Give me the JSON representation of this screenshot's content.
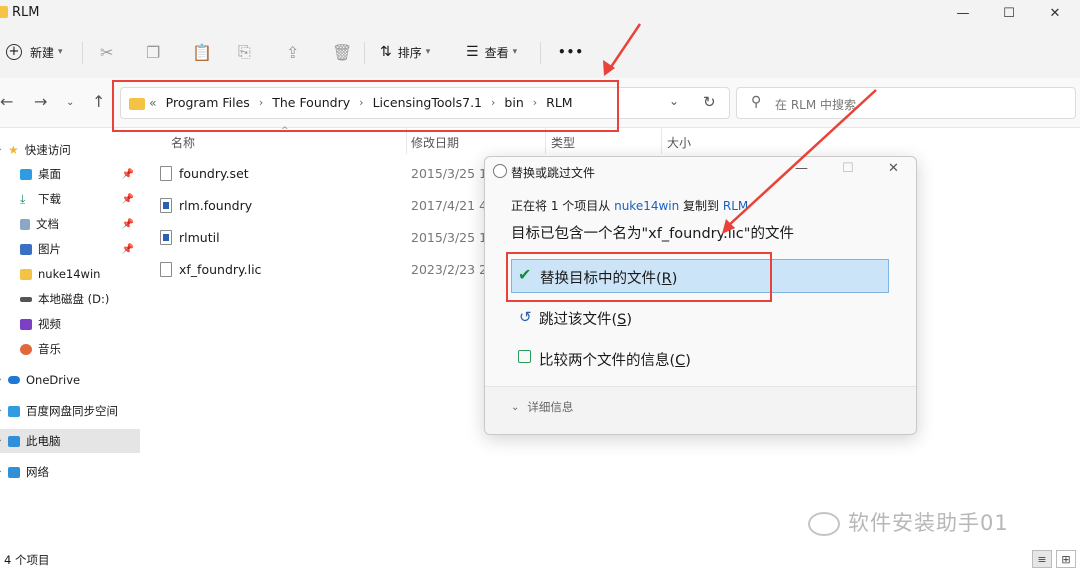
{
  "window": {
    "title": "RLM",
    "minimize": "—",
    "maximize": "☐",
    "close": "✕"
  },
  "toolbar": {
    "new_label": "新建",
    "new_icon": "plus-circle-icon",
    "sort_label": "排序",
    "view_label": "查看",
    "more_label": "•••",
    "chevron": "⌄"
  },
  "address": {
    "crumbs": [
      "Program Files",
      "The Foundry",
      "LicensingTools7.1",
      "bin",
      "RLM"
    ],
    "overflow": "«",
    "search_placeholder": "在 RLM 中搜索"
  },
  "sidebar": {
    "items": [
      {
        "label": "快速访问",
        "icon": "star-icon",
        "color": "#f3b531"
      },
      {
        "label": "桌面",
        "icon": "desktop-icon",
        "color": "#2f9be0",
        "pinned": true
      },
      {
        "label": "下载",
        "icon": "download-icon",
        "color": "#1a8a5a",
        "pinned": true
      },
      {
        "label": "文档",
        "icon": "documents-icon",
        "color": "#8ba7c7",
        "pinned": true
      },
      {
        "label": "图片",
        "icon": "pictures-icon",
        "color": "#3b6fc4",
        "pinned": true
      },
      {
        "label": "nuke14win",
        "icon": "folder-icon",
        "color": "#f4c245"
      },
      {
        "label": "本地磁盘 (D:)",
        "icon": "drive-icon",
        "color": "#555555"
      },
      {
        "label": "视频",
        "icon": "videos-icon",
        "color": "#7a3fc3"
      },
      {
        "label": "音乐",
        "icon": "music-icon",
        "color": "#e2683c"
      },
      {
        "label": "OneDrive",
        "icon": "cloud-icon",
        "color": "#1e78d4"
      },
      {
        "label": "百度网盘同步空间",
        "icon": "sync-icon",
        "color": "#2f9be0"
      },
      {
        "label": "此电脑",
        "icon": "pc-icon",
        "color": "#2f8fd8"
      },
      {
        "label": "网络",
        "icon": "network-icon",
        "color": "#2f8fd8"
      }
    ]
  },
  "columns": {
    "name": "名称",
    "modified": "修改日期",
    "type": "类型",
    "size": "大小"
  },
  "files": [
    {
      "name": "foundry.set",
      "date": "2015/3/25 14",
      "icon": "file-icon"
    },
    {
      "name": "rlm.foundry",
      "date": "2017/4/21 4:",
      "icon": "app-icon"
    },
    {
      "name": "rlmutil",
      "date": "2015/3/25 14",
      "icon": "app-icon"
    },
    {
      "name": "xf_foundry.lic",
      "date": "2023/2/23 20",
      "icon": "file-icon"
    }
  ],
  "dialog": {
    "title": "替换或跳过文件",
    "line1_prefix": "正在将 1 个项目从 ",
    "line1_source": "nuke14win",
    "line1_mid": " 复制到 ",
    "line1_dest": "RLM",
    "line2": "目标已包含一个名为\"xf_foundry.lic\"的文件",
    "options": [
      {
        "label": "替换目标中的文件",
        "key": "R",
        "icon": "check-icon"
      },
      {
        "label": "跳过该文件",
        "key": "S",
        "icon": "skip-icon"
      },
      {
        "label": "比较两个文件的信息",
        "key": "C",
        "icon": "compare-icon"
      }
    ],
    "details": "详细信息"
  },
  "status": {
    "count": "4 个项目"
  },
  "watermark": "软件安装助手01",
  "colors": {
    "annotation_red": "#e8423a",
    "highlight_blue": "#cce4f7",
    "link_blue": "#1d5fbf"
  }
}
